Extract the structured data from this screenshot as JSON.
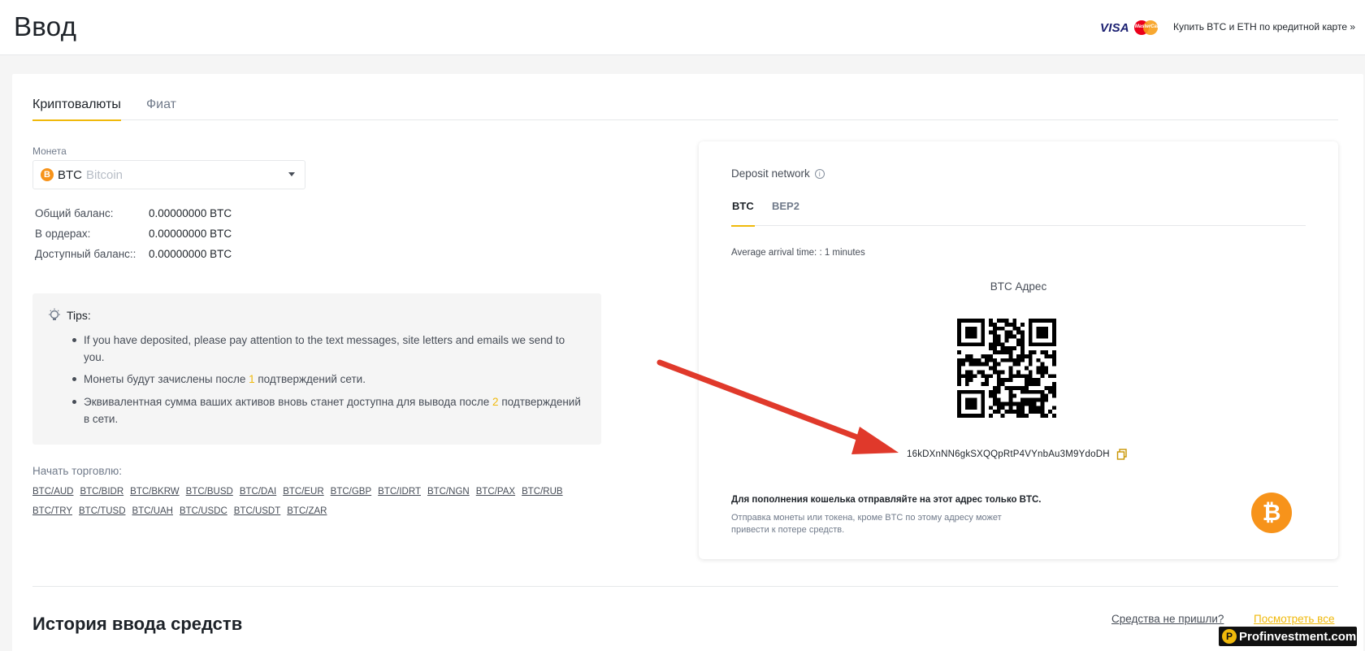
{
  "header": {
    "title": "Ввод",
    "visa_label": "VISA",
    "mastercard_label": "MasterCard",
    "buy_link": "Купить BTC и ETH по кредитной карте »"
  },
  "tabs": {
    "crypto": "Криптовалюты",
    "fiat": "Фиат"
  },
  "coin": {
    "label": "Монета",
    "symbol": "B",
    "code": "BTC",
    "name": "Bitcoin"
  },
  "balances": [
    {
      "label": "Общий баланс:",
      "value": "0.00000000 BTC"
    },
    {
      "label": "В ордерах:",
      "value": "0.00000000 BTC"
    },
    {
      "label": "Доступный баланс::",
      "value": "0.00000000 BTC"
    }
  ],
  "tips": {
    "heading": "Tips:",
    "items": [
      {
        "text": "If you have deposited, please pay attention to the text messages, site letters and emails we send to you."
      },
      {
        "pre": "Монеты будут зачислены после ",
        "num": "1",
        "post": " подтверждений сети."
      },
      {
        "pre": "Эквивалентная сумма ваших активов вновь станет доступна для вывода после ",
        "num": "2",
        "post": " подтверждений в сети."
      }
    ]
  },
  "trade": {
    "label": "Начать торговлю:",
    "pairs_row1": [
      "BTC/AUD",
      "BTC/BIDR",
      "BTC/BKRW",
      "BTC/BUSD",
      "BTC/DAI",
      "BTC/EUR",
      "BTC/GBP",
      "BTC/IDRT",
      "BTC/NGN",
      "BTC/PAX",
      "BTC/RUB"
    ],
    "pairs_row2": [
      "BTC/TRY",
      "BTC/TUSD",
      "BTC/UAH",
      "BTC/USDC",
      "BTC/USDT",
      "BTC/ZAR"
    ]
  },
  "deposit": {
    "title": "Deposit network",
    "info_icon": "ⓘ",
    "networks": [
      "BTC",
      "BEP2"
    ],
    "arrival": "Average arrival time: : 1 minutes",
    "address_title": "BTC Адрес",
    "address": "16kDXnNN6gkSXQQpRtP4VYnbAu3M9YdoDH",
    "warning_main": "Для пополнения кошелька отправляйте на этот адрес только BTC.",
    "warning_sub": "Отправка монеты или токена, кроме BTC по этому адресу может привести к потере средств.",
    "coin_symbol": "₿"
  },
  "history": {
    "title": "История ввода средств",
    "not_arrived": "Средства не пришли?",
    "view_all": "Посмотреть все"
  },
  "watermark": {
    "logo": "P",
    "text": "Profinvestment.com"
  },
  "colors": {
    "accent": "#f0b90b",
    "btc": "#f7931a",
    "arrow": "#e0392b"
  }
}
